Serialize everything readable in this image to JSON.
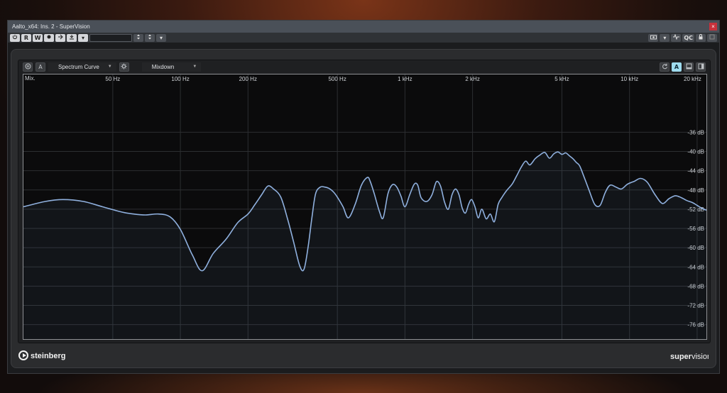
{
  "window": {
    "title": "Aalto_x64: Ins. 2 - SuperVision",
    "close_label": "×"
  },
  "host_toolbar": {
    "power_icon": "power-icon",
    "read_label": "R",
    "write_label": "W",
    "preset_value": ""
  },
  "host_toolbar_right": {
    "qc_label": "QC"
  },
  "module": {
    "channel_label": "A",
    "type_value": "Spectrum Curve",
    "source_value": "Mixdown",
    "active_channel_label": "A"
  },
  "plot": {
    "mode_label": "Mix."
  },
  "chart_data": {
    "type": "line",
    "title": "",
    "x_scale": "log",
    "xlim": [
      20,
      22000
    ],
    "ylim": [
      -79,
      -24
    ],
    "x_ticks": [
      {
        "value": 50,
        "label": "50 Hz"
      },
      {
        "value": 100,
        "label": "100 Hz"
      },
      {
        "value": 200,
        "label": "200 Hz"
      },
      {
        "value": 500,
        "label": "500 Hz"
      },
      {
        "value": 1000,
        "label": "1 kHz"
      },
      {
        "value": 2000,
        "label": "2 kHz"
      },
      {
        "value": 5000,
        "label": "5 kHz"
      },
      {
        "value": 10000,
        "label": "10 kHz"
      },
      {
        "value": 20000,
        "label": "20 kHz"
      }
    ],
    "y_ticks": [
      {
        "value": -36,
        "label": "-36 dB"
      },
      {
        "value": -40,
        "label": "-40 dB"
      },
      {
        "value": -44,
        "label": "-44 dB"
      },
      {
        "value": -48,
        "label": "-48 dB"
      },
      {
        "value": -52,
        "label": "-52 dB"
      },
      {
        "value": -56,
        "label": "-56 dB"
      },
      {
        "value": -60,
        "label": "-60 dB"
      },
      {
        "value": -64,
        "label": "-64 dB"
      },
      {
        "value": -68,
        "label": "-68 dB"
      },
      {
        "value": -72,
        "label": "-72 dB"
      },
      {
        "value": -76,
        "label": "-76 dB"
      }
    ],
    "grid": true,
    "line_color": "#8fb0de",
    "series": [
      {
        "x": [
          20,
          25,
          30,
          37,
          45,
          55,
          62,
          70,
          80,
          90,
          100,
          113,
          125,
          140,
          160,
          180,
          200,
          215,
          230,
          245,
          260,
          280,
          300,
          320,
          340,
          355,
          370,
          385,
          400,
          420,
          440,
          460,
          480,
          500,
          530,
          560,
          600,
          640,
          680,
          700,
          730,
          770,
          800,
          840,
          880,
          920,
          960,
          1000,
          1050,
          1100,
          1140,
          1180,
          1250,
          1320,
          1380,
          1440,
          1500,
          1560,
          1620,
          1680,
          1740,
          1800,
          1860,
          1920,
          1980,
          2050,
          2120,
          2200,
          2300,
          2400,
          2500,
          2600,
          2700,
          2850,
          3000,
          3150,
          3300,
          3450,
          3600,
          3800,
          4000,
          4200,
          4400,
          4600,
          4800,
          5000,
          5200,
          5400,
          5600,
          5800,
          6000,
          6300,
          6600,
          7000,
          7400,
          7800,
          8200,
          8700,
          9200,
          9800,
          10500,
          11200,
          12000,
          13000,
          14000,
          15000,
          16000,
          17000,
          18000,
          19000,
          20000,
          21000,
          22000
        ],
        "y": [
          -51.5,
          -50.4,
          -50.0,
          -50.4,
          -51.5,
          -52.6,
          -53.0,
          -53.2,
          -53.0,
          -53.6,
          -56.2,
          -61.5,
          -64.8,
          -61.2,
          -58.2,
          -54.8,
          -53.0,
          -51.0,
          -49.0,
          -47.2,
          -47.8,
          -49.5,
          -54.0,
          -59.0,
          -63.8,
          -64.5,
          -60.0,
          -53.8,
          -48.8,
          -47.4,
          -47.4,
          -47.7,
          -48.4,
          -49.5,
          -51.5,
          -53.8,
          -51.0,
          -47.0,
          -45.4,
          -46.2,
          -48.8,
          -52.5,
          -53.8,
          -48.8,
          -46.9,
          -47.4,
          -49.3,
          -51.5,
          -49.0,
          -46.8,
          -47.0,
          -49.6,
          -50.4,
          -49.0,
          -46.3,
          -47.2,
          -50.5,
          -52.0,
          -49.0,
          -47.8,
          -49.0,
          -51.8,
          -52.8,
          -51.0,
          -50.0,
          -51.5,
          -53.8,
          -52.0,
          -54.0,
          -53.0,
          -54.6,
          -51.0,
          -49.6,
          -48.0,
          -46.8,
          -45.0,
          -43.2,
          -42.0,
          -42.8,
          -41.5,
          -40.7,
          -40.2,
          -41.4,
          -40.5,
          -40.1,
          -40.6,
          -40.3,
          -40.9,
          -41.5,
          -42.3,
          -43.0,
          -45.5,
          -48.0,
          -51.0,
          -51.2,
          -48.5,
          -47.0,
          -47.4,
          -47.8,
          -46.8,
          -46.2,
          -45.6,
          -46.4,
          -49.0,
          -50.8,
          -49.8,
          -49.2,
          -49.6,
          -50.2,
          -50.6,
          -51.2,
          -51.8,
          -52.2
        ]
      }
    ]
  }
}
